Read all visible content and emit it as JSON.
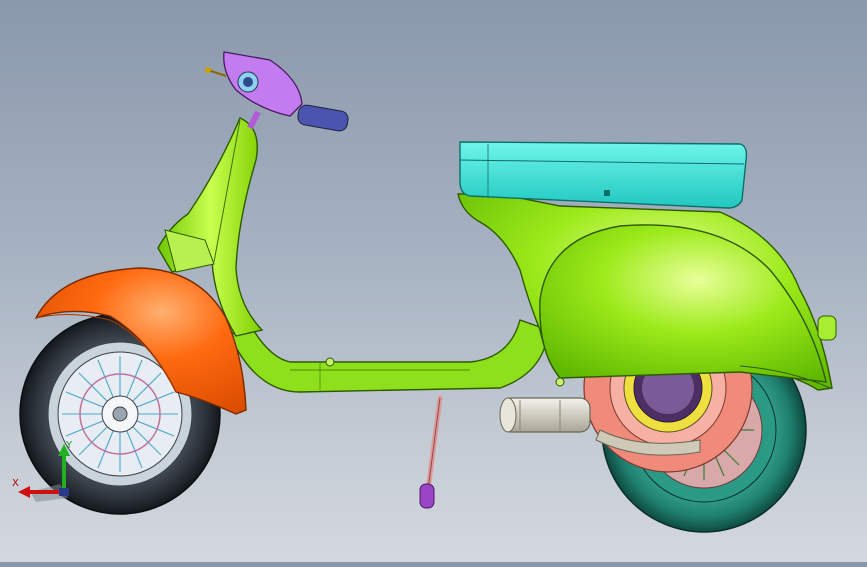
{
  "model": {
    "name": "scooter-assembly",
    "parts": [
      {
        "id": "front-fender",
        "color": "#ff6a10"
      },
      {
        "id": "front-wheel",
        "color": "#2d333b"
      },
      {
        "id": "rear-wheel",
        "color": "#1f7f6e"
      },
      {
        "id": "body-shell",
        "color": "#9cea1a"
      },
      {
        "id": "seat",
        "color": "#35e3d6"
      },
      {
        "id": "handlebar",
        "color": "#c27cf0"
      },
      {
        "id": "engine-drum",
        "color": "#f08a7a"
      },
      {
        "id": "muffler",
        "color": "#d8d4c8"
      },
      {
        "id": "kickstand",
        "color": "#e09a9a"
      }
    ]
  },
  "triad": {
    "x_label": "X",
    "y_label": "Y",
    "x_color": "#d01010",
    "y_color": "#20b020"
  }
}
